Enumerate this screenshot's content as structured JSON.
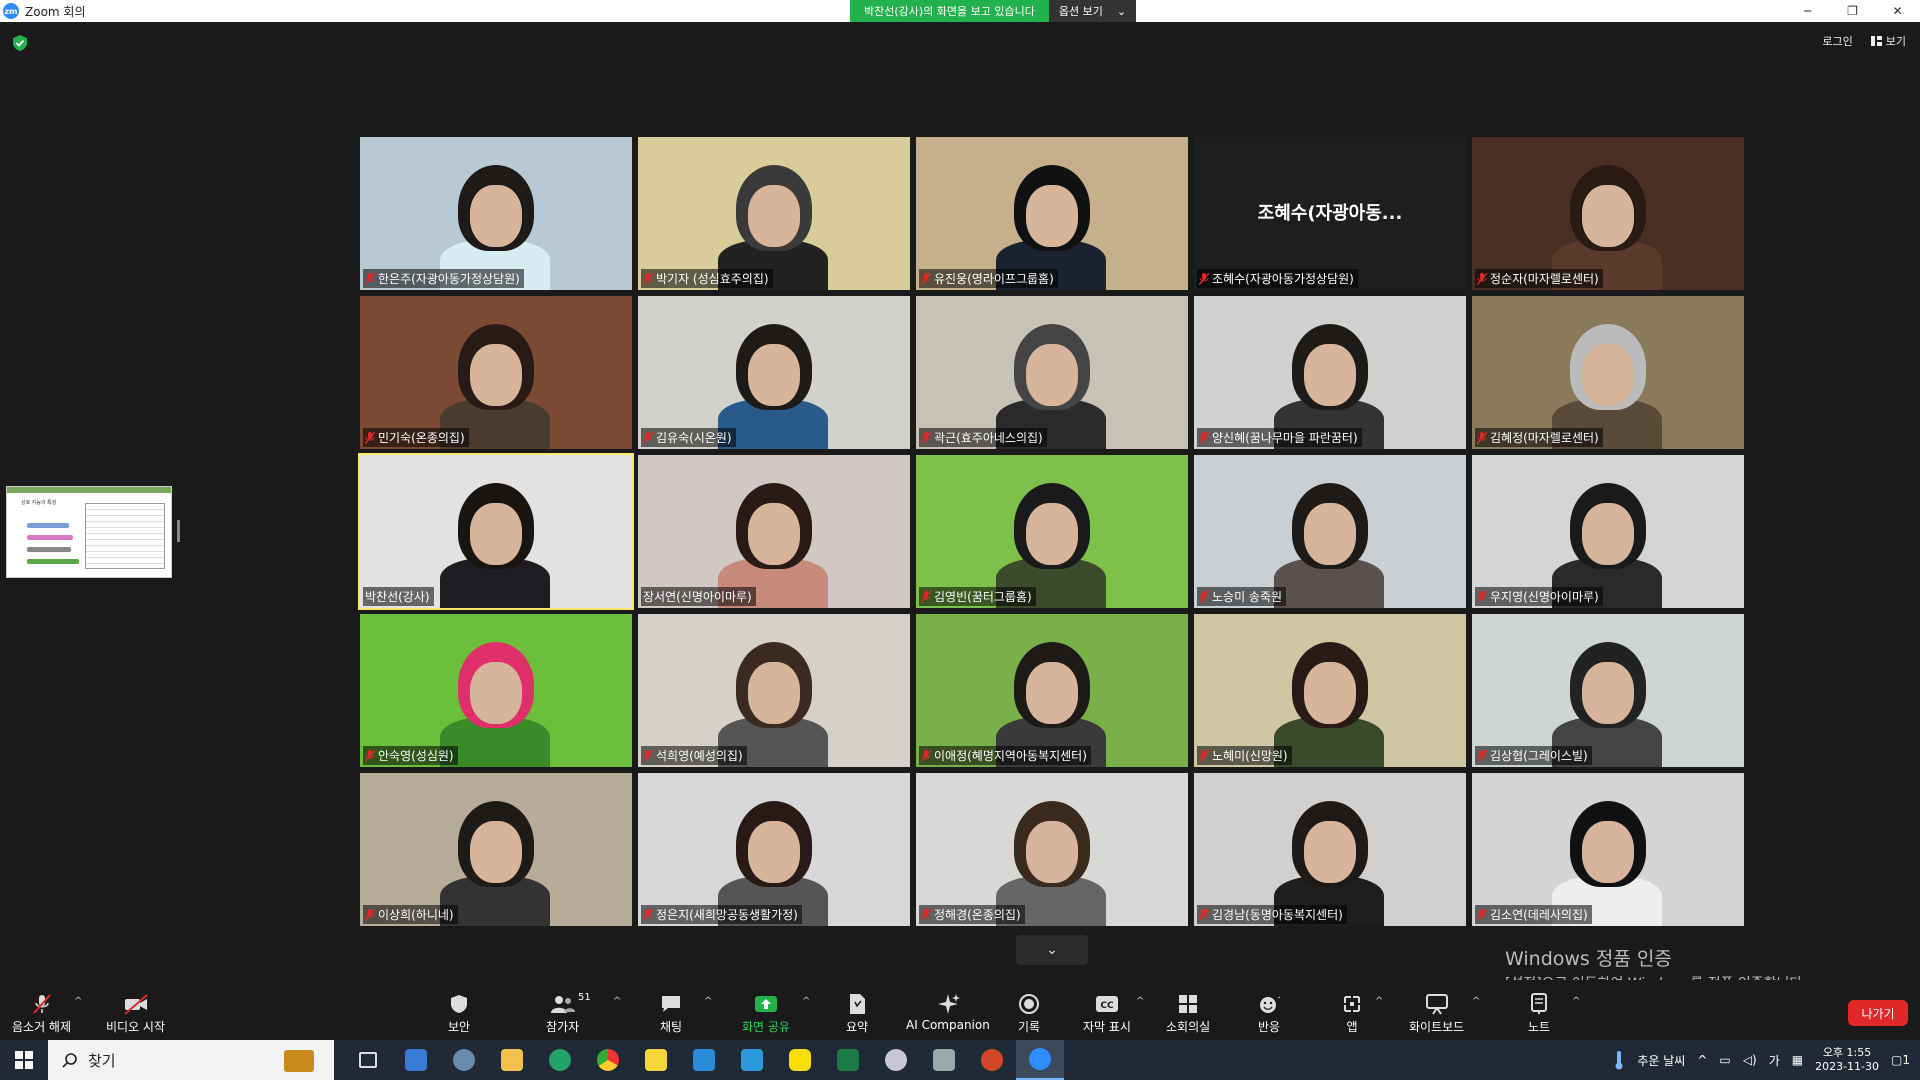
{
  "window": {
    "title": "Zoom 회의",
    "logo_text": "zm",
    "controls": [
      "─",
      "❐",
      "✕"
    ]
  },
  "share_banner": {
    "message": "박찬선(강사)의 화면을 보고 있습니다",
    "options_label": "옵션 보기",
    "caret": "⌄"
  },
  "top_right": {
    "login": "로그인",
    "view": "보기"
  },
  "participants": [
    {
      "name": "한은주(자광아동가정상담원)",
      "muted": true,
      "bg": "#b9c9d4",
      "hair": "#1e1a18",
      "shirt": "#d8ecf3"
    },
    {
      "name": "박기자 (성심효주의집)",
      "muted": true,
      "bg": "#d8cc9a",
      "hair": "#3a3a3a",
      "shirt": "#222"
    },
    {
      "name": "유진웅(영라이프그룹홈)",
      "muted": true,
      "bg": "#c6b08c",
      "hair": "#111",
      "shirt": "#1b2230"
    },
    {
      "name": "조혜수(자광아동가정상담원)",
      "muted": true,
      "bg": "#1e1e1e",
      "video_off": true,
      "big_label": "조혜수(자광아동..."
    },
    {
      "name": "정순자(마자렐로센터)",
      "muted": true,
      "bg": "#4a3024",
      "hair": "#2a1a14",
      "shirt": "#5a3a2a"
    },
    {
      "name": "민기숙(온종의집)",
      "muted": true,
      "bg": "#7a4a34",
      "hair": "#2a1a16",
      "shirt": "#4a3a30"
    },
    {
      "name": "김유숙(시온원)",
      "muted": true,
      "bg": "#d2d2cc",
      "hair": "#1e1a18",
      "shirt": "#2a5a8a"
    },
    {
      "name": "곽근(효주아네스의집)",
      "muted": true,
      "bg": "#c7c2b6",
      "hair": "#444",
      "shirt": "#2a2a2a"
    },
    {
      "name": "양신혜(꿈나무마을 파란꿈터)",
      "muted": true,
      "bg": "#d0d2d0",
      "hair": "#1e1a18",
      "shirt": "#333"
    },
    {
      "name": "김혜정(마자렐로센터)",
      "muted": true,
      "bg": "#8a7a5c",
      "hair": "#bbb",
      "shirt": "#5a4a3a"
    },
    {
      "name": "박찬선(강사)",
      "muted": false,
      "active": true,
      "bg": "#e2e2e2",
      "hair": "#1a1410",
      "shirt": "#1e1e22"
    },
    {
      "name": "장서연(신명아이마루)",
      "muted": false,
      "bg": "#cfc8c4",
      "hair": "#2a1a16",
      "shirt": "#c88a7a"
    },
    {
      "name": "김영빈(꿈터그룹홈)",
      "muted": true,
      "bg": "#7ec04a",
      "hair": "#1a1a1a",
      "shirt": "#3a4a2a"
    },
    {
      "name": "노승미 송죽원",
      "muted": true,
      "bg": "#c9cfd2",
      "hair": "#1e1a18",
      "shirt": "#5a5050"
    },
    {
      "name": "우지영(신명아이마루)",
      "muted": true,
      "bg": "#d4d6d6",
      "hair": "#1a1a1a",
      "shirt": "#2a2a2a"
    },
    {
      "name": "안숙영(성심원)",
      "muted": true,
      "bg": "#6cbf3a",
      "hair": "#e0306a",
      "shirt": "#3a8a2a"
    },
    {
      "name": "석희영(예성의집)",
      "muted": true,
      "bg": "#d6d0ca",
      "hair": "#3a2a22",
      "shirt": "#555"
    },
    {
      "name": "이애정(혜명지역아동복지센터)",
      "muted": true,
      "bg": "#7ab04a",
      "hair": "#1e1a18",
      "shirt": "#3a3a3a"
    },
    {
      "name": "노혜미(신망원)",
      "muted": true,
      "bg": "#cfc6a4",
      "hair": "#2a1a16",
      "shirt": "#3a4a2a"
    },
    {
      "name": "김상협(그레이스빌)",
      "muted": true,
      "bg": "#cfd5d0",
      "hair": "#222",
      "shirt": "#444"
    },
    {
      "name": "이상희(하니네)",
      "muted": true,
      "bg": "#b7ac9a",
      "hair": "#1e1a18",
      "shirt": "#333"
    },
    {
      "name": "정은지(새희망공동생활가정)",
      "muted": true,
      "bg": "#d6d8da",
      "hair": "#2a1a16",
      "shirt": "#555"
    },
    {
      "name": "정해경(온종의집)",
      "muted": true,
      "bg": "#d8d8d6",
      "hair": "#3a2a1e",
      "shirt": "#666"
    },
    {
      "name": "김경남(동명아동복지센터)",
      "muted": true,
      "bg": "#d2d0ce",
      "hair": "#1e1a18",
      "shirt": "#1e1e1e"
    },
    {
      "name": "김소연(데레사의집)",
      "muted": true,
      "bg": "#d4d4d6",
      "hair": "#111",
      "shirt": "#eee"
    }
  ],
  "shared_thumbnail": {
    "title": "상호 지능의 특징"
  },
  "scroll_down": "⌄",
  "windows_watermark": {
    "line1": "Windows 정품 인증",
    "line2": "[설정]으로 이동하여 Windows를 정품 인증합니다."
  },
  "toolbar": {
    "unmute": "음소거 해제",
    "start_video": "비디오 시작",
    "security": "보안",
    "participants": "참가자",
    "participants_count": "51",
    "chat": "채팅",
    "share_screen": "화면 공유",
    "summary": "요약",
    "ai_companion": "AI Companion",
    "record": "기록",
    "captions": "자막 표시",
    "breakout": "소회의실",
    "reactions": "반응",
    "apps": "앱",
    "whiteboard": "화이트보드",
    "notes": "노트",
    "leave": "나가기"
  },
  "taskbar": {
    "search_placeholder": "찾기",
    "weather": "추운 날씨",
    "ime": "가",
    "time": "오후 1:55",
    "date": "2023-11-30",
    "notif_count": "1"
  },
  "colors": {
    "share_green": "#23b14d",
    "leave_red": "#e02828",
    "active_speaker": "#f6e96b",
    "zoom_blue": "#2d8cff"
  }
}
